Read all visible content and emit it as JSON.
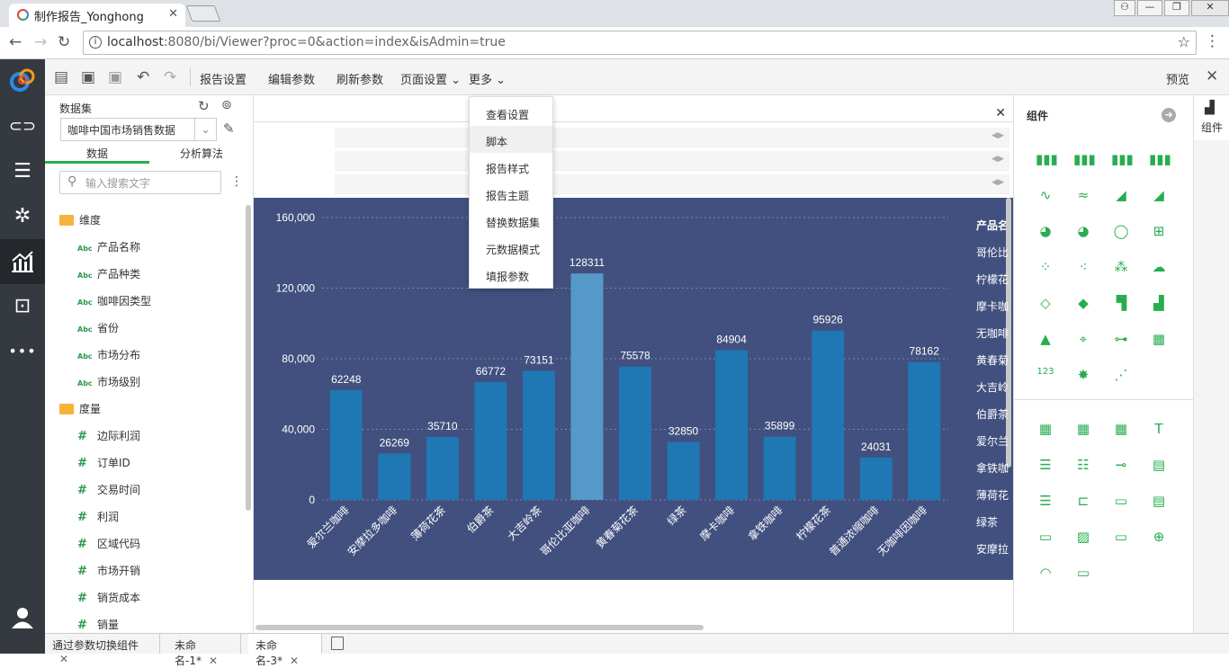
{
  "browser": {
    "tab_title": "制作报告_Yonghong",
    "tab_close": "✕",
    "url_host": "localhost",
    "url_rest": ":8080/bi/Viewer?proc=0&action=index&isAdmin=true",
    "win_user": "⚇",
    "win_min": "—",
    "win_max": "❐",
    "win_close": "✕",
    "back": "←",
    "forward": "→",
    "reload": "↻",
    "star": "☆",
    "menu": "⋮",
    "info": "i"
  },
  "leftnav": {
    "items": [
      {
        "name": "link-icon",
        "glyph": "⊂⊃"
      },
      {
        "name": "dashboard-icon",
        "glyph": "☰"
      },
      {
        "name": "network-icon",
        "glyph": "✲"
      },
      {
        "name": "report-chart-icon",
        "glyph": "▟"
      },
      {
        "name": "presentation-icon",
        "glyph": "⊡"
      },
      {
        "name": "more-icon",
        "glyph": "•••"
      },
      {
        "name": "user-icon",
        "glyph": "👤"
      }
    ]
  },
  "toolbar": {
    "report_settings": "报告设置",
    "edit_params": "编辑参数",
    "refresh_params": "刷新参数",
    "page_settings": "页面设置 ⌄",
    "more": "更多 ⌄",
    "preview": "预览",
    "close": "✕"
  },
  "dataset": {
    "title": "数据集",
    "selected": "咖啡中国市场销售数据",
    "caret": "⌄",
    "tab_data": "数据",
    "tab_algo": "分析算法",
    "search_placeholder": "输入搜索文字",
    "dim_folder": "维度",
    "measure_folder": "度量",
    "text_prefix": "Abc",
    "num_prefix": "#",
    "dimensions": [
      "产品名称",
      "产品种类",
      "咖啡因类型",
      "省份",
      "市场分布",
      "市场级别"
    ],
    "measures": [
      "边际利润",
      "订单ID",
      "交易时间",
      "利润",
      "区域代码",
      "市场开销",
      "销货成本",
      "销量"
    ]
  },
  "menu": {
    "items": [
      "查看设置",
      "脚本",
      "报告样式",
      "报告主题",
      "替换数据集",
      "元数据模式",
      "填报参数"
    ],
    "highlighted": 1
  },
  "canvas": {
    "close": "✕"
  },
  "chart_data": {
    "type": "bar",
    "categories": [
      "爱尔兰咖啡",
      "安摩拉多咖啡",
      "薄荷花茶",
      "伯爵茶",
      "大吉岭茶",
      "哥伦比亚咖啡",
      "黄春菊花茶",
      "绿茶",
      "摩卡咖啡",
      "拿铁咖啡",
      "柠檬花茶",
      "普通浓缩咖啡",
      "无咖啡因咖啡"
    ],
    "values": [
      62248,
      26269,
      35710,
      66772,
      73151,
      128311,
      75578,
      32850,
      84904,
      35899,
      95926,
      24031,
      78162
    ],
    "highlight_index": 5,
    "ylim": [
      0,
      160000
    ],
    "yticks": [
      "0",
      "40,000",
      "80,000",
      "120,000",
      "160,000"
    ],
    "colors": {
      "bar": "#1f77b4",
      "highlight": "#5599c8",
      "background": "#41507e",
      "grid": "#7a86a8",
      "text": "#ffffff"
    },
    "legend": {
      "title": "产品名",
      "items": [
        "哥伦比",
        "柠檬花",
        "摩卡咖",
        "无咖啡",
        "黄春菊",
        "大吉岭",
        "伯爵茶",
        "爱尔兰",
        "拿铁咖",
        "薄荷花",
        "绿茶",
        "安摩拉"
      ]
    }
  },
  "components": {
    "title": "组件",
    "side_label": "组件"
  },
  "bottom_tabs": [
    {
      "label": "通过参数切换组件"
    },
    {
      "label": "未命名-1*"
    },
    {
      "label": "未命名-3*",
      "active": true
    }
  ],
  "bottom_close": "✕"
}
